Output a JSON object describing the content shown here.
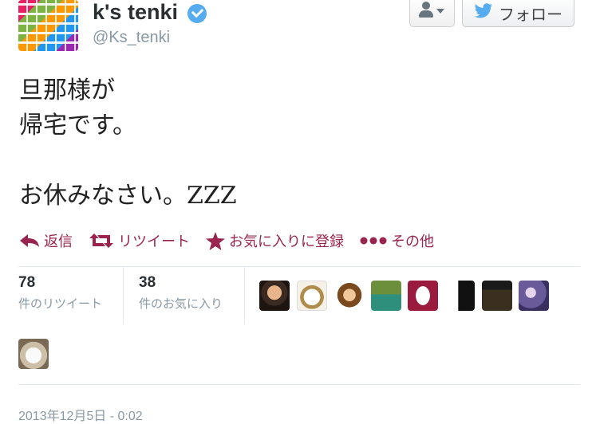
{
  "user": {
    "name": "k's tenki",
    "handle": "@Ks_tenki"
  },
  "buttons": {
    "follow": "フォロー"
  },
  "tweet": {
    "text": "旦那様が\n帰宅です。\n\nお休みなさい。ZZZ"
  },
  "actions": {
    "reply": "返信",
    "retweet": "リツイート",
    "favorite": "お気に入りに登録",
    "more": "その他"
  },
  "stats": {
    "retweets": {
      "count": "78",
      "label": "件のリツイート"
    },
    "favorites": {
      "count": "38",
      "label": "件のお気に入り"
    }
  },
  "timestamp": "2013年12月5日 - 0:02",
  "colors": {
    "accent": "#99244f",
    "verified": "#55acee",
    "muted": "#8899a6"
  },
  "icons": [
    "verified-badge-icon",
    "user-icon",
    "caret-down-icon",
    "twitter-bird-icon",
    "reply-icon",
    "retweet-icon",
    "star-icon",
    "more-dots-icon"
  ]
}
